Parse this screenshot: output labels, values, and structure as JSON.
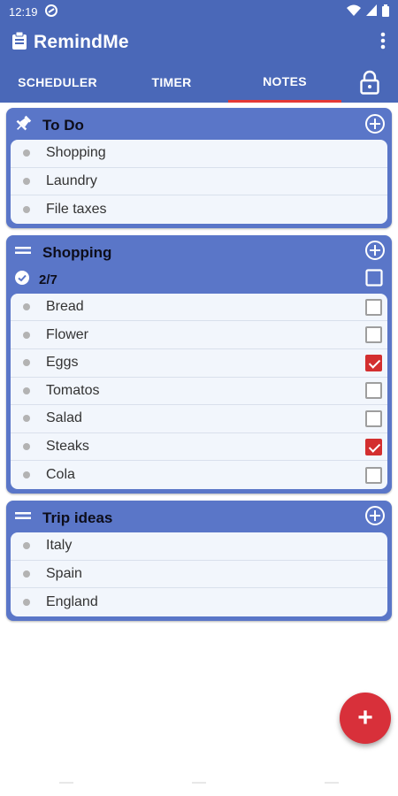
{
  "statusbar": {
    "time": "12:19"
  },
  "appbar": {
    "title": "RemindMe",
    "menu_icon": "more-vert-icon"
  },
  "tabs": [
    {
      "label": "SCHEDULER"
    },
    {
      "label": "TIMER"
    },
    {
      "label": "NOTES",
      "selected": true
    }
  ],
  "colors": {
    "primary": "#4a68b8",
    "card": "#5a76c8",
    "accent": "#d8303a"
  },
  "notes": [
    {
      "title": "To Do",
      "items": [
        "Shopping",
        "Laundry",
        "File taxes"
      ]
    },
    {
      "title": "Shopping",
      "count": "2/7",
      "items": [
        {
          "label": "Bread",
          "checked": false
        },
        {
          "label": "Flower",
          "checked": false
        },
        {
          "label": "Eggs",
          "checked": true
        },
        {
          "label": "Tomatos",
          "checked": false
        },
        {
          "label": "Salad",
          "checked": false
        },
        {
          "label": "Steaks",
          "checked": true
        },
        {
          "label": "Cola",
          "checked": false
        }
      ]
    },
    {
      "title": "Trip ideas",
      "items": [
        "Italy",
        "Spain",
        "England"
      ]
    }
  ],
  "fab": {
    "label": "+"
  }
}
